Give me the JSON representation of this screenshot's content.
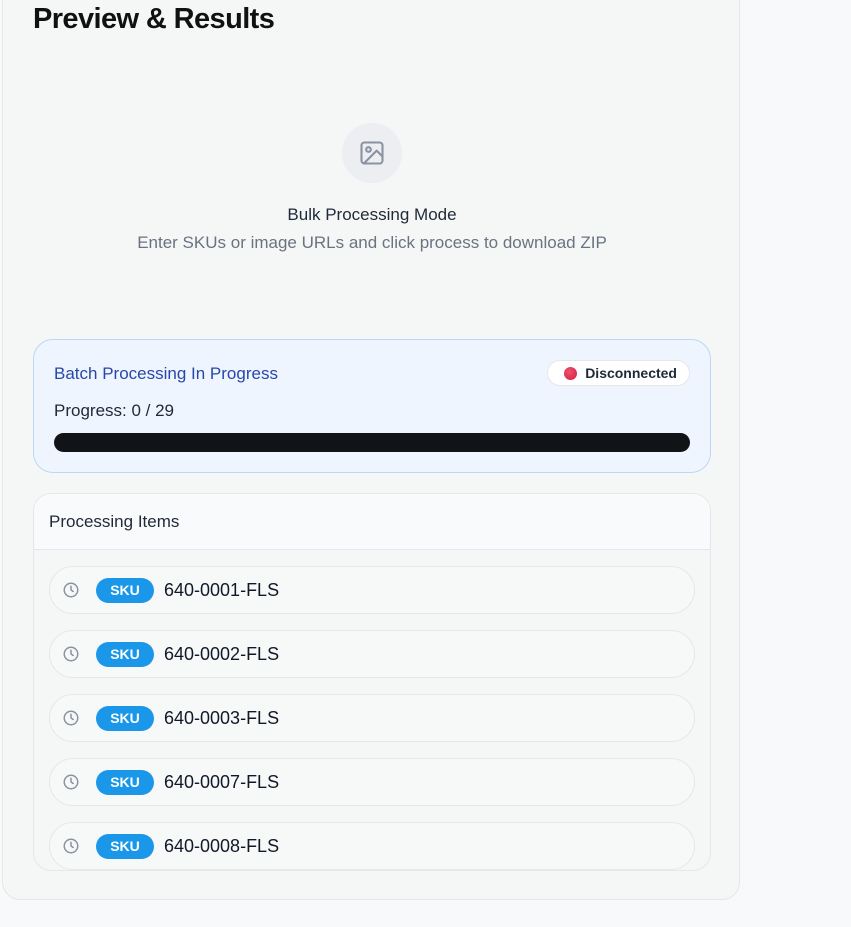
{
  "header": {
    "title": "Preview & Results"
  },
  "empty_state": {
    "icon": "image-icon",
    "heading": "Bulk Processing Mode",
    "description": "Enter SKUs or image URLs and click process to download ZIP"
  },
  "batch": {
    "title": "Batch Processing In Progress",
    "status_label": "Disconnected",
    "status_color": "#e11d48",
    "progress_label": "Progress: 0 / 29",
    "progress_done": 0,
    "progress_total": 29,
    "progress_fraction": 0
  },
  "items": {
    "header": "Processing Items",
    "status_icon": "clock-icon",
    "list": [
      {
        "badge": "SKU",
        "code": "640-0001-FLS"
      },
      {
        "badge": "SKU",
        "code": "640-0002-FLS"
      },
      {
        "badge": "SKU",
        "code": "640-0003-FLS"
      },
      {
        "badge": "SKU",
        "code": "640-0007-FLS"
      },
      {
        "badge": "SKU",
        "code": "640-0008-FLS"
      }
    ]
  },
  "colors": {
    "accent": "#1a97e8",
    "batch_title": "#2847a8",
    "progress_track": "#111417"
  }
}
